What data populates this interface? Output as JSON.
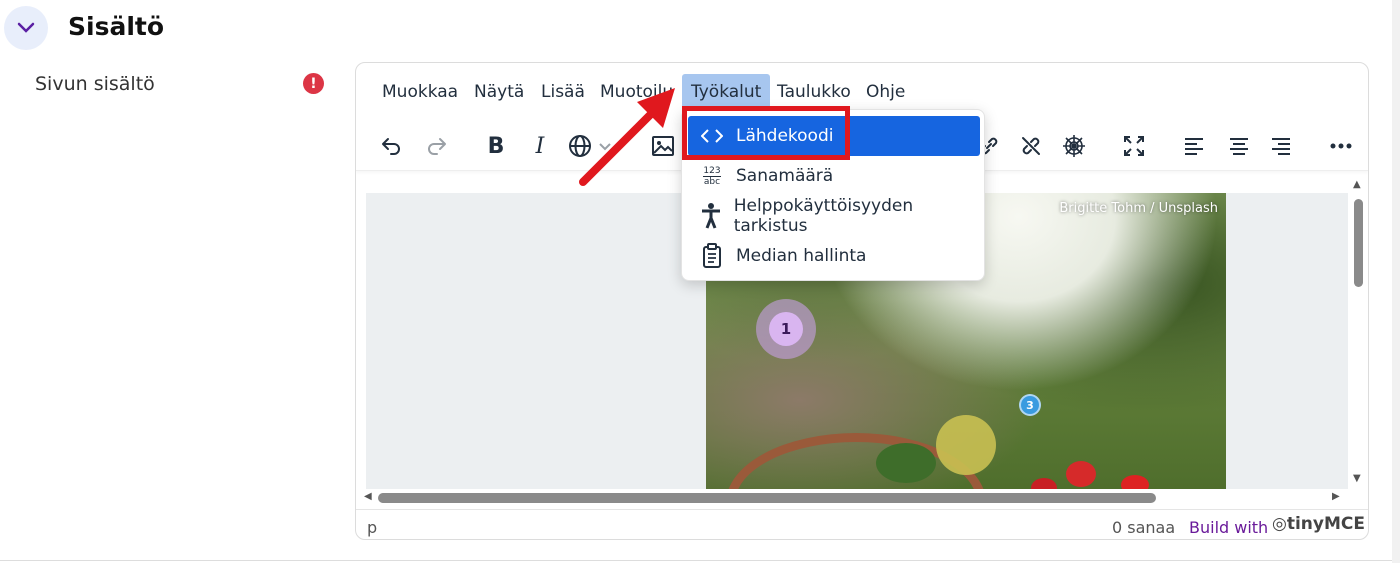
{
  "section": {
    "title": "Sisältö"
  },
  "field": {
    "label": "Sivun sisältö",
    "error_glyph": "!"
  },
  "menubar": {
    "items": [
      "Muokkaa",
      "Näytä",
      "Lisää",
      "Muotoilu",
      "Työkalut",
      "Taulukko",
      "Ohje"
    ],
    "active": "Työkalut"
  },
  "toolbar": {
    "icons": [
      "undo-icon",
      "redo-icon",
      "bold-icon",
      "italic-icon",
      "language-icon",
      "image-icon",
      "link-icon",
      "unlink-icon",
      "anchor-icon",
      "fullscreen-icon",
      "align-left-icon",
      "align-center-icon",
      "align-right-icon",
      "more-icon"
    ]
  },
  "dropdown": {
    "items": [
      {
        "label": "Lähdekoodi",
        "icon": "code-icon",
        "selected": true
      },
      {
        "label": "Sanamäärä",
        "icon": "word-count-icon",
        "selected": false
      },
      {
        "label": "Helppokäyttöisyyden tarkistus",
        "icon": "accessibility-icon",
        "selected": false
      },
      {
        "label": "Median hallinta",
        "icon": "media-manager-icon",
        "selected": false
      }
    ],
    "word_count_icon_top": "123",
    "word_count_icon_bottom": "abc"
  },
  "content": {
    "photo_credit": "Brigitte Tohm / Unsplash",
    "hotspots": [
      "1",
      "3"
    ]
  },
  "statusbar": {
    "path": "p",
    "word_count": "0 sanaa",
    "build_with": "Build with",
    "brand": "tinyMCE"
  },
  "colors": {
    "accent_selected": "#1665e0",
    "menu_active": "#a7c6ef",
    "annotation_red": "#e0181e",
    "error": "#dc3545",
    "build_with": "#6a1b9a"
  }
}
